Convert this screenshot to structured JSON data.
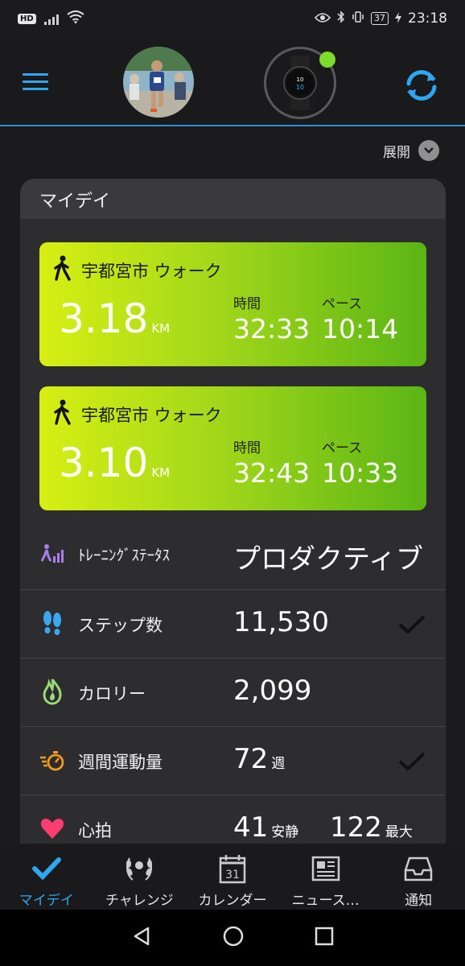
{
  "status_bar": {
    "left_badge": "HD",
    "battery": "37",
    "time": "23:18"
  },
  "header": {
    "expand_label": "展開"
  },
  "card": {
    "title": "マイデイ",
    "activities": [
      {
        "name": "宇都宮市 ウォーク",
        "distance": "3.18",
        "distance_unit": "KM",
        "time_label": "時間",
        "time_value": "32:33",
        "pace_label": "ペース",
        "pace_value": "10:14"
      },
      {
        "name": "宇都宮市 ウォーク",
        "distance": "3.10",
        "distance_unit": "KM",
        "time_label": "時間",
        "time_value": "32:43",
        "pace_label": "ペース",
        "pace_value": "10:33"
      }
    ],
    "stats": [
      {
        "label": "ﾄﾚｰﾆﾝｸﾞｽﾃｰﾀｽ",
        "value": "プロダクティブ",
        "icon": "training-status-icon"
      },
      {
        "label": "ステップ数",
        "value": "11,530",
        "icon": "footsteps-icon",
        "checked": true
      },
      {
        "label": "カロリー",
        "value": "2,099",
        "icon": "flame-icon"
      },
      {
        "label": "週間運動量",
        "value": "72",
        "unit": "週",
        "icon": "stopwatch-icon",
        "checked": true
      },
      {
        "label": "心拍",
        "value": "41",
        "unit": "安静",
        "value2": "122",
        "unit2": "最大",
        "icon": "heart-icon"
      }
    ]
  },
  "bottom_nav": {
    "items": [
      {
        "label": "マイデイ",
        "icon": "check-icon",
        "active": true
      },
      {
        "label": "チャレンジ",
        "icon": "laurel-icon"
      },
      {
        "label": "カレンダー",
        "icon": "calendar-icon",
        "day": "31"
      },
      {
        "label": "ニュース…",
        "icon": "newspaper-icon"
      },
      {
        "label": "通知",
        "icon": "inbox-icon"
      }
    ]
  },
  "colors": {
    "accent": "#2ea7f2",
    "activity_gradient_start": "#d7ef13",
    "activity_gradient_end": "#5bb515",
    "watch_status": "#7ddb2b"
  }
}
